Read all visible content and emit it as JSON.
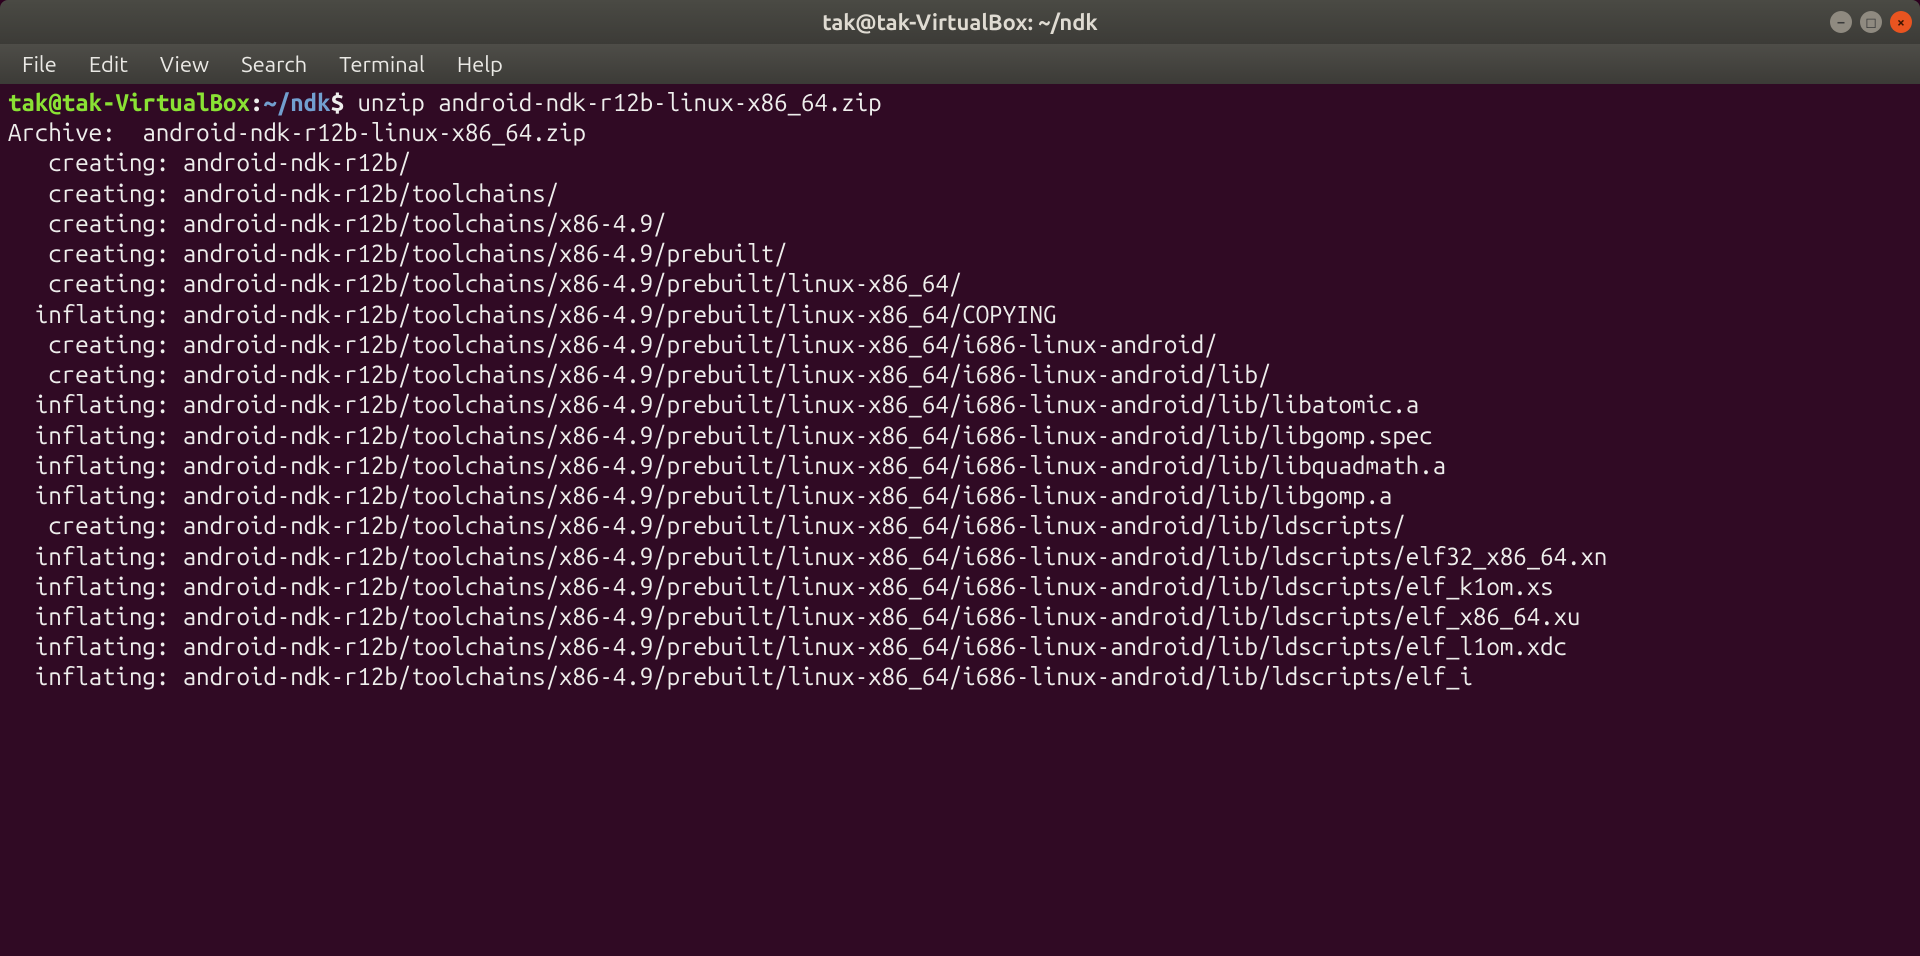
{
  "titlebar": {
    "title": "tak@tak-VirtualBox: ~/ndk"
  },
  "menu": {
    "file": "File",
    "edit": "Edit",
    "view": "View",
    "search": "Search",
    "terminal": "Terminal",
    "help": "Help"
  },
  "prompt": {
    "userhost": "tak@tak-VirtualBox",
    "colon": ":",
    "path": "~/ndk",
    "dollar": "$ ",
    "command": "unzip android-ndk-r12b-linux-x86_64.zip"
  },
  "output_lines": [
    "Archive:  android-ndk-r12b-linux-x86_64.zip",
    "   creating: android-ndk-r12b/",
    "   creating: android-ndk-r12b/toolchains/",
    "   creating: android-ndk-r12b/toolchains/x86-4.9/",
    "   creating: android-ndk-r12b/toolchains/x86-4.9/prebuilt/",
    "   creating: android-ndk-r12b/toolchains/x86-4.9/prebuilt/linux-x86_64/",
    "  inflating: android-ndk-r12b/toolchains/x86-4.9/prebuilt/linux-x86_64/COPYING",
    "   creating: android-ndk-r12b/toolchains/x86-4.9/prebuilt/linux-x86_64/i686-linux-android/",
    "   creating: android-ndk-r12b/toolchains/x86-4.9/prebuilt/linux-x86_64/i686-linux-android/lib/",
    "  inflating: android-ndk-r12b/toolchains/x86-4.9/prebuilt/linux-x86_64/i686-linux-android/lib/libatomic.a",
    "  inflating: android-ndk-r12b/toolchains/x86-4.9/prebuilt/linux-x86_64/i686-linux-android/lib/libgomp.spec",
    "  inflating: android-ndk-r12b/toolchains/x86-4.9/prebuilt/linux-x86_64/i686-linux-android/lib/libquadmath.a",
    "  inflating: android-ndk-r12b/toolchains/x86-4.9/prebuilt/linux-x86_64/i686-linux-android/lib/libgomp.a",
    "   creating: android-ndk-r12b/toolchains/x86-4.9/prebuilt/linux-x86_64/i686-linux-android/lib/ldscripts/",
    "  inflating: android-ndk-r12b/toolchains/x86-4.9/prebuilt/linux-x86_64/i686-linux-android/lib/ldscripts/elf32_x86_64.xn",
    "  inflating: android-ndk-r12b/toolchains/x86-4.9/prebuilt/linux-x86_64/i686-linux-android/lib/ldscripts/elf_k1om.xs",
    "  inflating: android-ndk-r12b/toolchains/x86-4.9/prebuilt/linux-x86_64/i686-linux-android/lib/ldscripts/elf_x86_64.xu",
    "  inflating: android-ndk-r12b/toolchains/x86-4.9/prebuilt/linux-x86_64/i686-linux-android/lib/ldscripts/elf_l1om.xdc",
    "  inflating: android-ndk-r12b/toolchains/x86-4.9/prebuilt/linux-x86_64/i686-linux-android/lib/ldscripts/elf_i"
  ],
  "window_controls": {
    "min_glyph": "–",
    "max_glyph": "◻",
    "close_glyph": "×"
  }
}
